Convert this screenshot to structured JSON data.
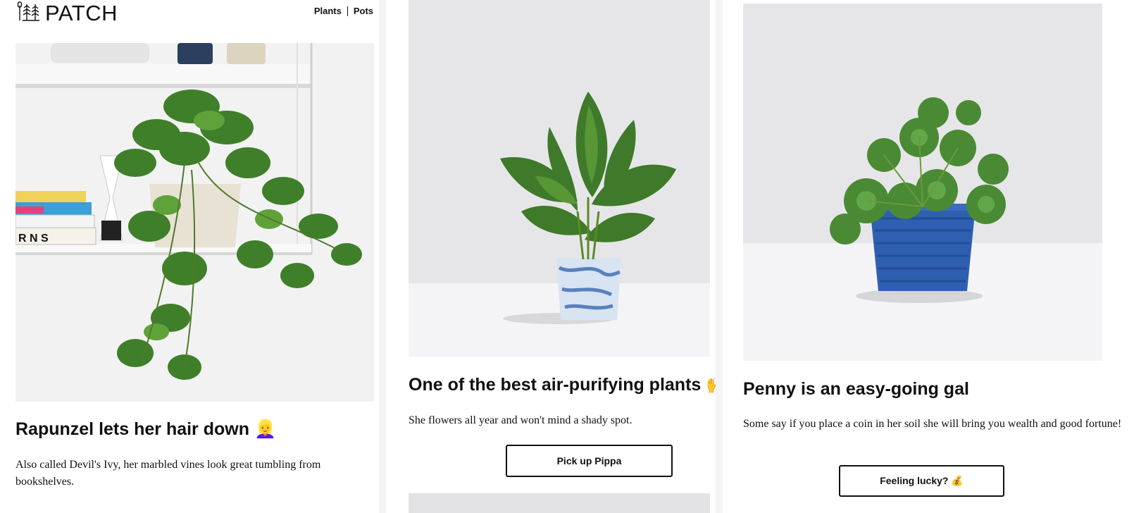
{
  "brand": {
    "name": "PATCH",
    "logo_icon": "plant-tools-icon"
  },
  "nav": {
    "items": [
      "Plants",
      "Pots"
    ]
  },
  "cards": [
    {
      "title": "Rapunzel lets her hair down",
      "title_emoji": "👱‍♀️",
      "description": "Also called Devil's Ivy, her marbled vines look great tumbling from bookshelves.",
      "image_subject": "trailing-pothos-plant-on-shelf"
    },
    {
      "title": "One of the best air-purifying plants",
      "title_emoji": "🙌",
      "description": "She flowers all year and won't mind a shady spot.",
      "button_label": "Pick up Pippa",
      "image_subject": "peace-lily-in-marbled-blue-pot"
    },
    {
      "title": "Penny is an easy-going gal",
      "title_emoji": "",
      "description": "Some say if you place a coin in her soil she will bring you wealth and good fortune!",
      "button_label": "Feeling lucky? 💰",
      "image_subject": "pilea-in-blue-ribbed-pot"
    }
  ],
  "colors": {
    "text": "#111111",
    "photo_wall": "#e6e6e8",
    "photo_floor": "#f4f4f6",
    "leaf": "#3f7f2a",
    "pot_blue": "#2f5fb0"
  }
}
